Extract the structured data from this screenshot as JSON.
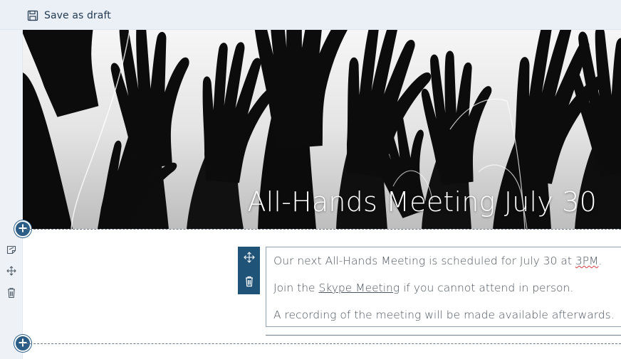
{
  "toolbar": {
    "save_draft_label": "Save as draft",
    "save_draft_icon": "floppy-disk-icon"
  },
  "hero": {
    "title": "All-Hands Meeting July 30",
    "image_description_icon": "raised-hands-image"
  },
  "text_webpart": {
    "para1_before": "Our next All-Hands Meeting is scheduled for July 30 at ",
    "para1_flagged": "3PM",
    "para1_after": ".",
    "para2_before": "Join the ",
    "para2_link": "Skype Meeting",
    "para2_after": " if you cannot attend in person.",
    "para3": "A recording of the meeting will be made available afterwards."
  },
  "icons": {
    "add_section": "plus-circle-icon",
    "edit_section": "edit-icon",
    "move_section": "move-icon",
    "delete_section": "trash-icon",
    "webpart_move": "move-icon",
    "webpart_delete": "trash-icon"
  },
  "colors": {
    "accent": "#2b5d86",
    "toolbar_bg": "#eaf0f6",
    "webpart_toolbar": "#1f5377",
    "spellcheck": "#d23b3b"
  }
}
